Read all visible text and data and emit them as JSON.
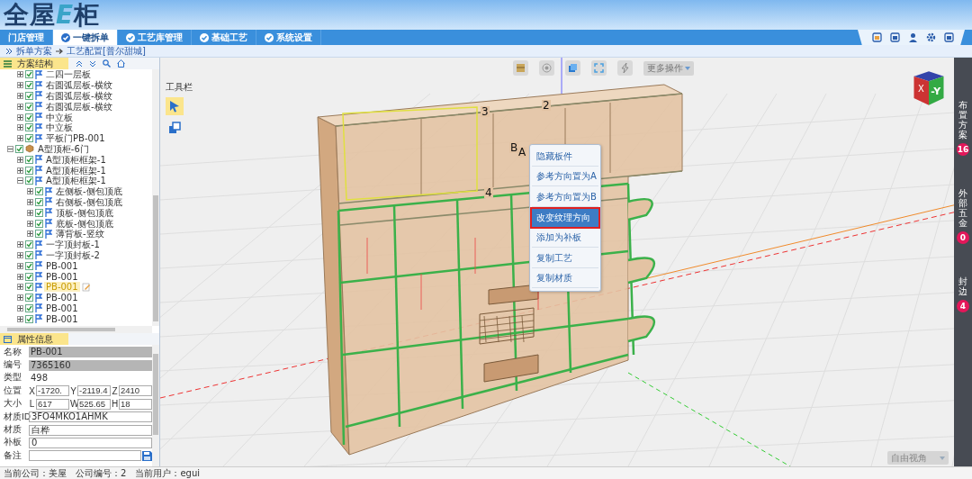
{
  "header": {
    "logo": [
      {
        "text": "全屋",
        "accent": false
      },
      {
        "text": "E",
        "accent": true
      },
      {
        "text": "柜",
        "accent": false
      }
    ]
  },
  "nav_tabs": [
    {
      "label": "门店管理",
      "selected": false,
      "icon": false
    },
    {
      "label": "一键拆单",
      "selected": true,
      "icon": true
    },
    {
      "label": "工艺库管理",
      "selected": false,
      "icon": true
    },
    {
      "label": "基础工艺",
      "selected": false,
      "icon": true
    },
    {
      "label": "系统设置",
      "selected": false,
      "icon": true
    }
  ],
  "breadcrumb": [
    "拆单方案",
    "工艺配置[普尔甜城]"
  ],
  "tree_panel": {
    "title": "方案结构",
    "continued_items": [
      {
        "label": "二四一层板",
        "kind": "part",
        "checked": true,
        "expanded": false,
        "selected": false
      },
      {
        "label": "右圆弧层板-横纹",
        "kind": "part",
        "checked": true,
        "expanded": false,
        "selected": false
      },
      {
        "label": "右圆弧层板-横纹",
        "kind": "part",
        "checked": true,
        "expanded": false,
        "selected": false
      },
      {
        "label": "右圆弧层板-横纹",
        "kind": "part",
        "checked": true,
        "expanded": false,
        "selected": false
      },
      {
        "label": "中立板",
        "kind": "part",
        "checked": true,
        "expanded": false,
        "selected": false
      },
      {
        "label": "中立板",
        "kind": "part",
        "checked": true,
        "expanded": false,
        "selected": false
      },
      {
        "label": "平板门PB-001",
        "kind": "part",
        "checked": true,
        "expanded": false,
        "selected": false
      }
    ],
    "nodes": [
      {
        "label": "A型顶柜-6门",
        "kind": "cabinet",
        "checked": true,
        "expanded": true,
        "selected": false,
        "children": [
          {
            "label": "A型顶柜框架-1",
            "kind": "part",
            "checked": true,
            "expanded": false,
            "selected": false
          },
          {
            "label": "A型顶柜框架-1",
            "kind": "part",
            "checked": true,
            "expanded": false,
            "selected": false
          },
          {
            "label": "A型顶柜框架-1",
            "kind": "part",
            "checked": true,
            "expanded": true,
            "selected": false,
            "children": [
              {
                "label": "左侧板-侧包顶底",
                "kind": "part",
                "checked": true,
                "expanded": false,
                "selected": false
              },
              {
                "label": "右侧板-侧包顶底",
                "kind": "part",
                "checked": true,
                "expanded": false,
                "selected": false
              },
              {
                "label": "顶板-侧包顶底",
                "kind": "part",
                "checked": true,
                "expanded": false,
                "selected": false
              },
              {
                "label": "底板-侧包顶底",
                "kind": "part",
                "checked": true,
                "expanded": false,
                "selected": false
              },
              {
                "label": "薄背板-竖纹",
                "kind": "part",
                "checked": true,
                "expanded": false,
                "selected": false
              }
            ]
          },
          {
            "label": "一字顶封板-1",
            "kind": "part",
            "checked": true,
            "expanded": false,
            "selected": false
          },
          {
            "label": "一字顶封板-2",
            "kind": "part",
            "checked": true,
            "expanded": false,
            "selected": false
          },
          {
            "label": "PB-001",
            "kind": "part",
            "checked": true,
            "expanded": false,
            "selected": false
          },
          {
            "label": "PB-001",
            "kind": "part",
            "checked": true,
            "expanded": false,
            "selected": false
          },
          {
            "label": "PB-001",
            "kind": "part",
            "checked": true,
            "expanded": false,
            "selected": true
          },
          {
            "label": "PB-001",
            "kind": "part",
            "checked": true,
            "expanded": false,
            "selected": false
          },
          {
            "label": "PB-001",
            "kind": "part",
            "checked": true,
            "expanded": false,
            "selected": false
          },
          {
            "label": "PB-001",
            "kind": "part",
            "checked": true,
            "expanded": false,
            "selected": false
          }
        ]
      }
    ]
  },
  "properties": {
    "title": "属性信息",
    "rows": [
      {
        "label": "名称",
        "kind": "readonly",
        "value": "PB-001"
      },
      {
        "label": "编号",
        "kind": "readonly",
        "value": "7365160"
      },
      {
        "label": "类型",
        "kind": "plain",
        "value": "498"
      },
      {
        "label": "位置",
        "kind": "triple",
        "parts": [
          {
            "axis": "X",
            "value": "-1720."
          },
          {
            "axis": "Y",
            "value": "-2119.4"
          },
          {
            "axis": "Z",
            "value": "2410"
          }
        ]
      },
      {
        "label": "大小",
        "kind": "triple",
        "parts": [
          {
            "axis": "L",
            "value": "617"
          },
          {
            "axis": "W",
            "value": "525.65"
          },
          {
            "axis": "H",
            "value": "18"
          }
        ]
      },
      {
        "label": "材质ID",
        "kind": "input",
        "value": "3FO4MKO1AHMK"
      },
      {
        "label": "材质",
        "kind": "input",
        "value": "白桦"
      },
      {
        "label": "补板",
        "kind": "input",
        "value": "0"
      },
      {
        "label": "备注",
        "kind": "note"
      }
    ]
  },
  "viewport": {
    "toolbox_title": "工具栏",
    "more_menu": "更多操作",
    "point_labels": [
      "3",
      "2",
      "B",
      "A",
      "4"
    ],
    "cube_labels": [
      "X",
      "-Y"
    ],
    "context_menu": [
      {
        "label": "隐藏板件",
        "selected": false
      },
      {
        "label": "参考方向置为A",
        "selected": false
      },
      {
        "label": "参考方向置为B",
        "selected": false
      },
      {
        "label": "改变纹理方向",
        "selected": true
      },
      {
        "label": "添加为补板",
        "selected": false
      },
      {
        "label": "复制工艺",
        "selected": false
      },
      {
        "label": "复制材质",
        "selected": false
      }
    ],
    "view_select": "自由视角"
  },
  "right_sidebar": [
    {
      "label": "布置方案",
      "count": "16"
    },
    {
      "label": "外部五金",
      "count": "0"
    },
    {
      "label": "封边",
      "count": "4"
    }
  ],
  "status_bar": [
    "当前公司：美屋",
    "公司编号：2",
    "当前用户：egui"
  ]
}
